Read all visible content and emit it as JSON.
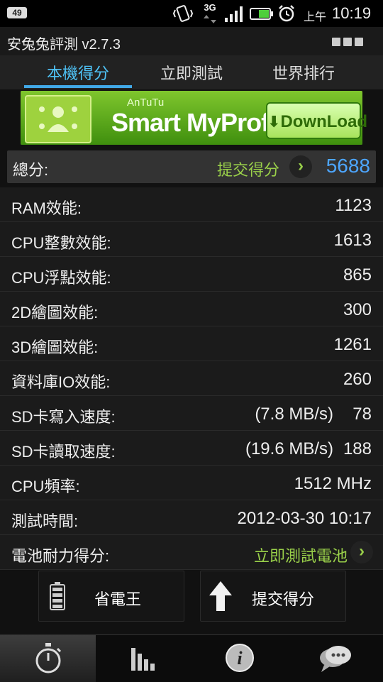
{
  "status_bar": {
    "notification_badge": "49",
    "network": "3G",
    "ampm": "上午",
    "time": "10:19"
  },
  "app": {
    "title": "安兔兔評測 v2.7.3"
  },
  "tabs": [
    {
      "label": "本機得分"
    },
    {
      "label": "立即測試"
    },
    {
      "label": "世界排行"
    }
  ],
  "banner": {
    "brand": "AnTuTu",
    "title": "Smart MyProfile",
    "download": "DownLoad"
  },
  "total": {
    "label": "總分:",
    "submit_link": "提交得分",
    "score": "5688"
  },
  "rows": [
    {
      "label": "RAM效能:",
      "value": "1123"
    },
    {
      "label": "CPU整數效能:",
      "value": "1613"
    },
    {
      "label": "CPU浮點效能:",
      "value": "865"
    },
    {
      "label": "2D繪圖效能:",
      "value": "300"
    },
    {
      "label": "3D繪圖效能:",
      "value": "1261"
    },
    {
      "label": "資料庫IO效能:",
      "value": "260"
    }
  ],
  "sd_write": {
    "label": "SD卡寫入速度:",
    "speed": "(7.8 MB/s)",
    "value": "78"
  },
  "sd_read": {
    "label": "SD卡讀取速度:",
    "speed": "(19.6 MB/s)",
    "value": "188"
  },
  "cpu_freq": {
    "label": "CPU頻率:",
    "value": "1512 MHz"
  },
  "test_time": {
    "label": "測試時間:",
    "value": "2012-03-30 10:17"
  },
  "battery": {
    "label": "電池耐力得分:",
    "link": "立即測試電池"
  },
  "buttons": {
    "power_saver": "省電王",
    "submit_score": "提交得分"
  },
  "bottom_nav": [
    {
      "icon": "stopwatch-icon"
    },
    {
      "icon": "bar-chart-icon"
    },
    {
      "icon": "info-icon"
    },
    {
      "icon": "chat-icon"
    }
  ],
  "colors": {
    "accent_blue": "#41a8e6",
    "score_blue": "#4da6ff",
    "link_green": "#9ad04a"
  }
}
